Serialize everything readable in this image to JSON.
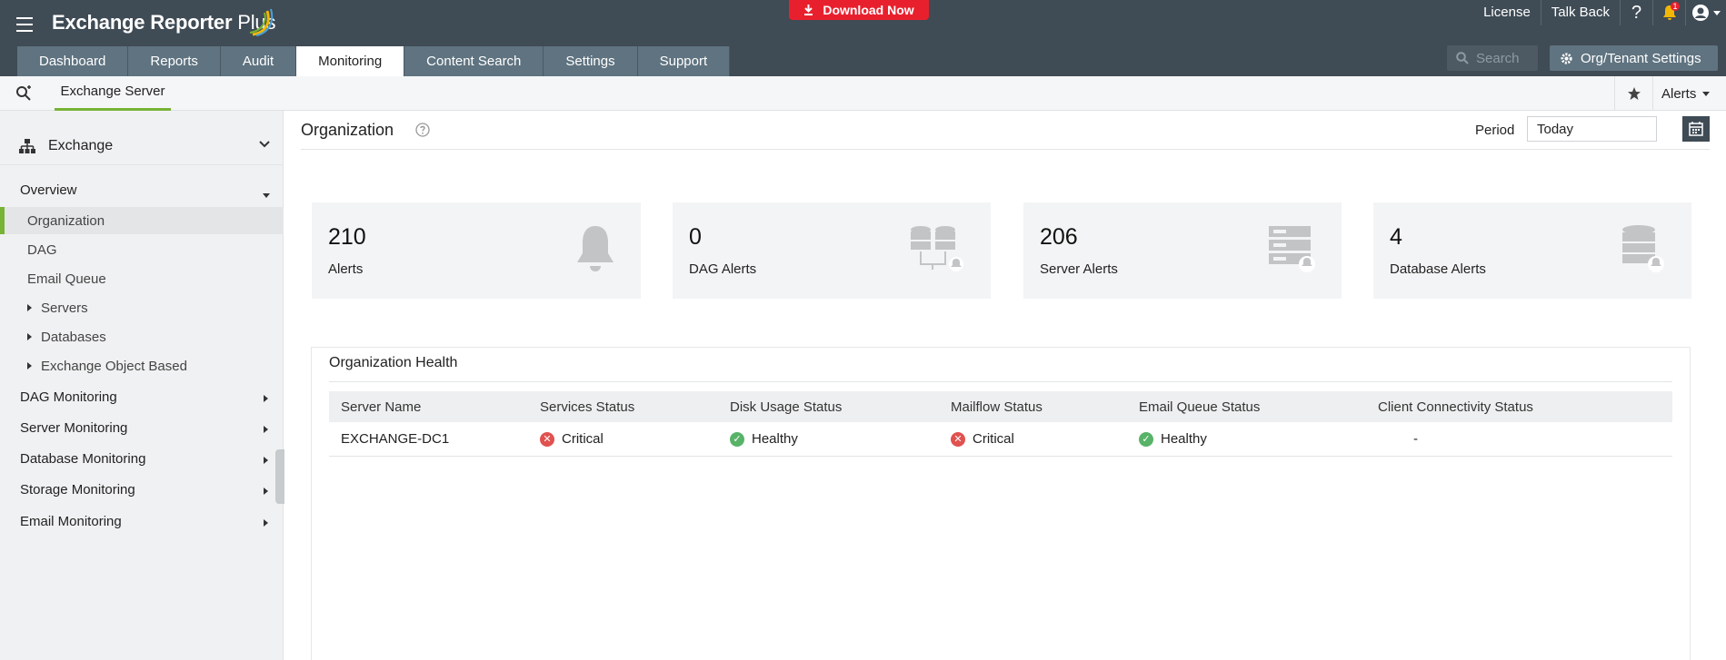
{
  "header": {
    "app_name": "Exchange Reporter",
    "app_name_suffix": "Plus",
    "download_label": "Download Now",
    "links": {
      "license": "License",
      "talk_back": "Talk Back"
    },
    "help_label": "?",
    "notification_count": "1",
    "search_placeholder": "Search",
    "org_settings_label": "Org/Tenant Settings",
    "tabs": [
      {
        "label": "Dashboard"
      },
      {
        "label": "Reports"
      },
      {
        "label": "Audit"
      },
      {
        "label": "Monitoring"
      },
      {
        "label": "Content Search"
      },
      {
        "label": "Settings"
      },
      {
        "label": "Support"
      }
    ],
    "active_tab": "Monitoring",
    "colors": {
      "header_bg": "#3f4b55",
      "tab_bg": "#5f7380",
      "download_bg": "#e8202e",
      "accent": "#78b335"
    }
  },
  "subnav": {
    "active_subtab": "Exchange Server",
    "alerts_menu_label": "Alerts"
  },
  "sidebar": {
    "section_title": "Exchange",
    "items": [
      {
        "label": "Overview"
      },
      {
        "label": "Organization"
      },
      {
        "label": "DAG"
      },
      {
        "label": "Email Queue"
      },
      {
        "label": "Servers"
      },
      {
        "label": "Databases"
      },
      {
        "label": "Exchange Object Based"
      },
      {
        "label": "DAG Monitoring"
      },
      {
        "label": "Server Monitoring"
      },
      {
        "label": "Database Monitoring"
      },
      {
        "label": "Storage Monitoring"
      },
      {
        "label": "Email Monitoring"
      }
    ],
    "active_item": "Organization"
  },
  "main": {
    "title": "Organization",
    "period_label": "Period",
    "period_value": "Today",
    "cards": [
      {
        "count": "210",
        "label": "Alerts",
        "icon": "bell-icon"
      },
      {
        "count": "0",
        "label": "DAG Alerts",
        "icon": "dag-alert-icon"
      },
      {
        "count": "206",
        "label": "Server Alerts",
        "icon": "server-alert-icon"
      },
      {
        "count": "4",
        "label": "Database Alerts",
        "icon": "database-alert-icon"
      }
    ],
    "health": {
      "title": "Organization Health",
      "columns": [
        "Server Name",
        "Services Status",
        "Disk Usage Status",
        "Mailflow Status",
        "Email Queue Status",
        "Client Connectivity Status"
      ],
      "rows": [
        {
          "server_name": "EXCHANGE-DC1",
          "services_status": "Critical",
          "disk_usage_status": "Healthy",
          "mailflow_status": "Critical",
          "email_queue_status": "Healthy",
          "client_connectivity_status": "-"
        }
      ],
      "status_colors": {
        "Critical": "#e0524f",
        "Healthy": "#58b368"
      }
    }
  }
}
